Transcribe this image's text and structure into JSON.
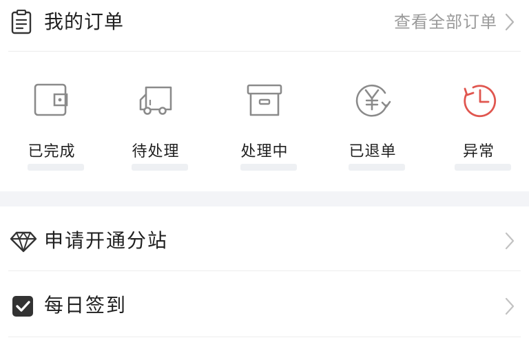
{
  "orders": {
    "title": "我的订单",
    "view_all": "查看全部订单",
    "statuses": [
      {
        "label": "已完成",
        "icon": "wallet-icon"
      },
      {
        "label": "待处理",
        "icon": "truck-icon"
      },
      {
        "label": "处理中",
        "icon": "archive-box-icon"
      },
      {
        "label": "已退单",
        "icon": "yen-refund-icon"
      },
      {
        "label": "异常",
        "icon": "clock-alert-icon"
      }
    ]
  },
  "menu": {
    "items": [
      {
        "label": "申请开通分站",
        "icon": "diamond-icon"
      },
      {
        "label": "每日签到",
        "icon": "checkbox-checked-icon"
      }
    ]
  },
  "colors": {
    "text_primary": "#1f1f1f",
    "text_secondary": "#9a9a9a",
    "icon_gray": "#8a8a8a",
    "alert_red": "#e0564f",
    "separator": "#f3f4f7"
  }
}
